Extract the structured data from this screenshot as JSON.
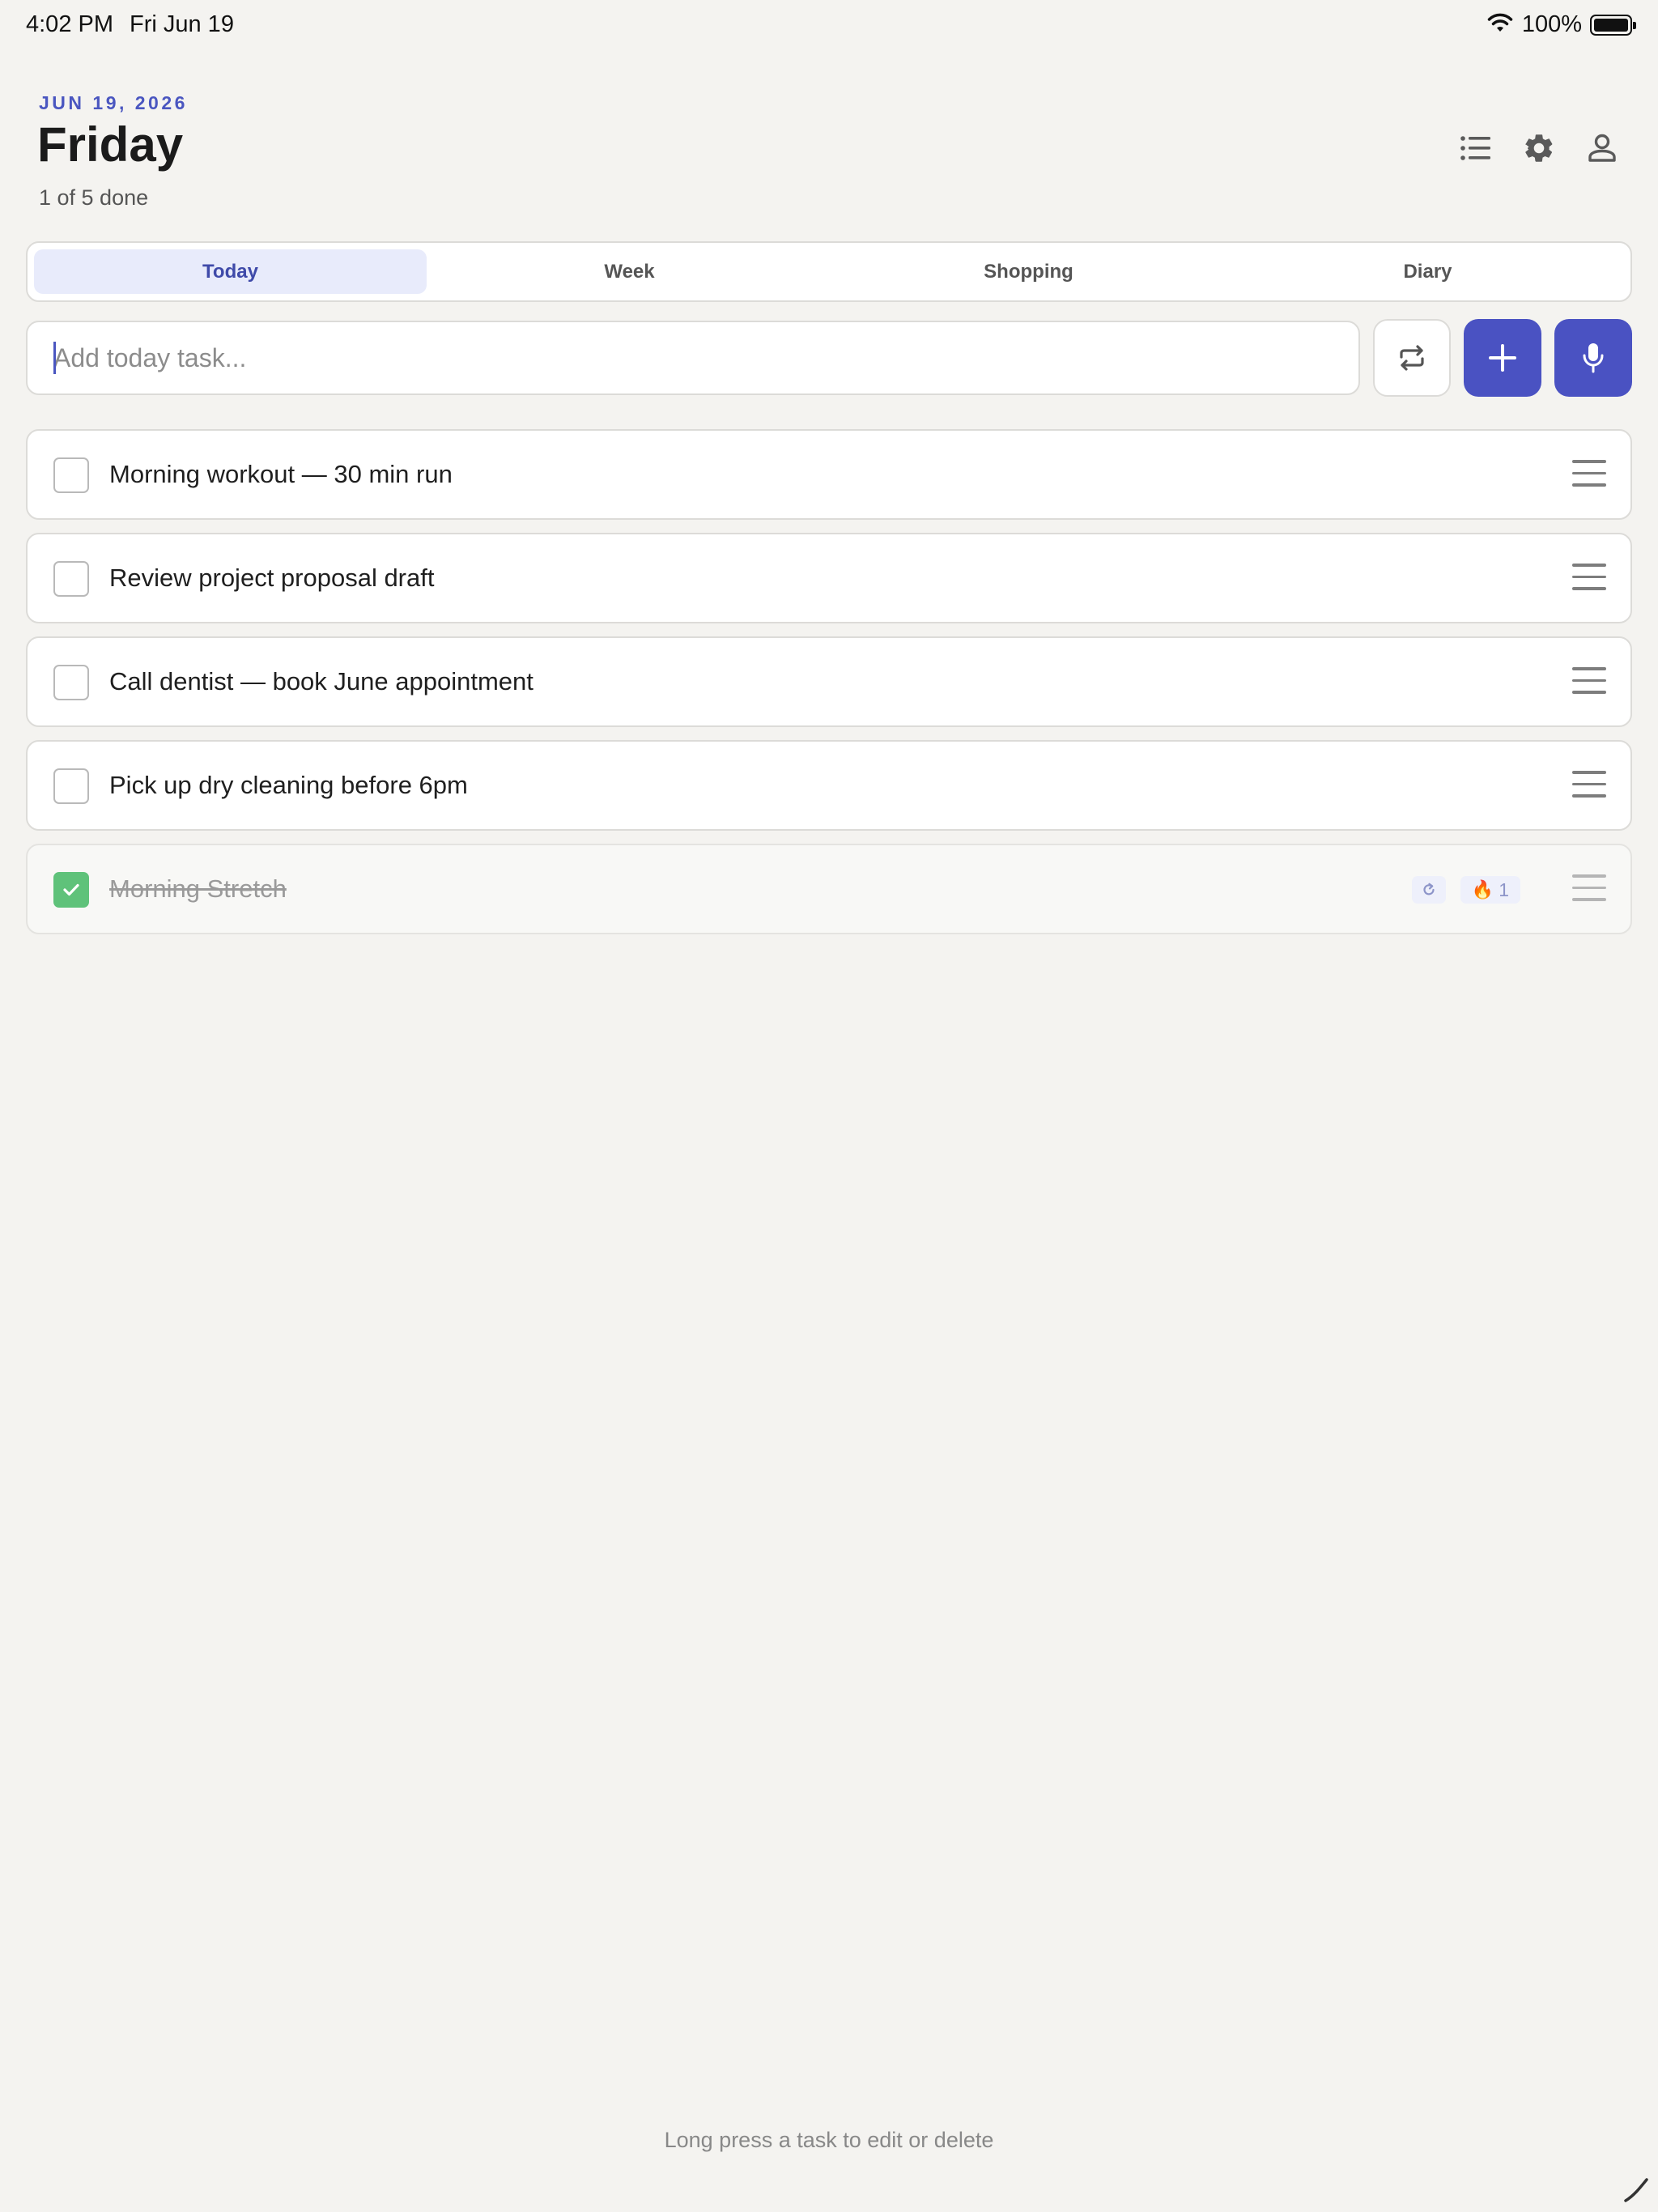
{
  "status_bar": {
    "time": "4:02 PM",
    "date": "Fri Jun 19",
    "battery": "100%",
    "icons": [
      "wifi-icon",
      "battery-icon"
    ]
  },
  "header": {
    "date": "JUN 19, 2026",
    "title": "Friday",
    "progress": "1 of 5 done",
    "actions": [
      "list-icon",
      "gear-icon",
      "person-icon"
    ]
  },
  "tabs": [
    {
      "label": "Today",
      "active": true
    },
    {
      "label": "Week",
      "active": false
    },
    {
      "label": "Shopping",
      "active": false
    },
    {
      "label": "Diary",
      "active": false
    }
  ],
  "input": {
    "placeholder": "Add today task...",
    "value": ""
  },
  "tasks": [
    {
      "text": "Morning workout — 30 min run",
      "done": false
    },
    {
      "text": "Review project proposal draft",
      "done": false
    },
    {
      "text": "Call dentist — book June appointment",
      "done": false
    },
    {
      "text": "Pick up dry cleaning before 6pm",
      "done": false
    },
    {
      "text": "Morning Stretch",
      "done": true,
      "repeat": true,
      "streak": "1"
    }
  ],
  "footer": {
    "hint": "Long press a task to edit or delete"
  },
  "colors": {
    "accent": "#4a52c2",
    "background": "#f4f3f0",
    "done_check": "#5fc27a",
    "active_tab": "#e8ebfb"
  }
}
